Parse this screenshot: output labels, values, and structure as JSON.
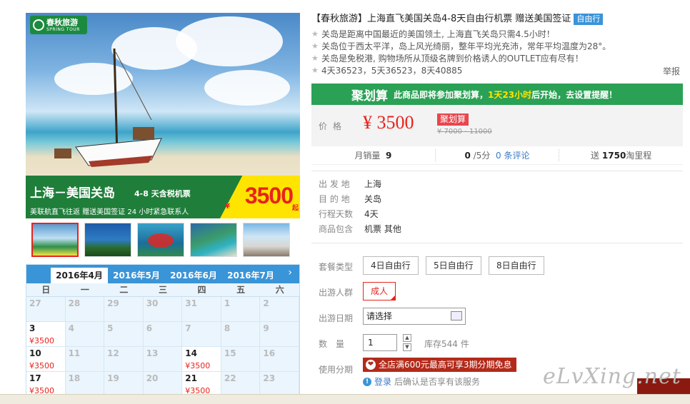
{
  "hero": {
    "logo_cn": "春秋旅游",
    "logo_en": "SPRING TOUR",
    "banner_title": "上海－美国关岛",
    "banner_sub": "4-8 天含税机票",
    "banner_line": "美联航直飞往返 赠送美国签证 24 小时紧急联系人",
    "banner_price": "3500",
    "banner_yen": "¥",
    "banner_qi": "起"
  },
  "thumbnails": [
    "thumb-1",
    "thumb-2",
    "thumb-3",
    "thumb-4",
    "thumb-5"
  ],
  "calendar": {
    "months": [
      "2016年4月",
      "2016年5月",
      "2016年6月",
      "2016年7月"
    ],
    "selected_month_index": 0,
    "next": "›",
    "weekdays": [
      "日",
      "一",
      "二",
      "三",
      "四",
      "五",
      "六"
    ],
    "days": [
      {
        "d": "27",
        "p": ""
      },
      {
        "d": "28",
        "p": ""
      },
      {
        "d": "29",
        "p": ""
      },
      {
        "d": "30",
        "p": ""
      },
      {
        "d": "31",
        "p": ""
      },
      {
        "d": "1",
        "p": ""
      },
      {
        "d": "2",
        "p": ""
      },
      {
        "d": "3",
        "p": "¥3500"
      },
      {
        "d": "4",
        "p": ""
      },
      {
        "d": "5",
        "p": ""
      },
      {
        "d": "6",
        "p": ""
      },
      {
        "d": "7",
        "p": ""
      },
      {
        "d": "8",
        "p": ""
      },
      {
        "d": "9",
        "p": ""
      },
      {
        "d": "10",
        "p": "¥3500"
      },
      {
        "d": "11",
        "p": ""
      },
      {
        "d": "12",
        "p": ""
      },
      {
        "d": "13",
        "p": ""
      },
      {
        "d": "14",
        "p": "¥3500"
      },
      {
        "d": "15",
        "p": ""
      },
      {
        "d": "16",
        "p": ""
      },
      {
        "d": "17",
        "p": "¥3500"
      },
      {
        "d": "18",
        "p": ""
      },
      {
        "d": "19",
        "p": ""
      },
      {
        "d": "20",
        "p": ""
      },
      {
        "d": "21",
        "p": "¥3500"
      },
      {
        "d": "22",
        "p": ""
      },
      {
        "d": "23",
        "p": ""
      }
    ]
  },
  "product": {
    "title": "【春秋旅游】上海直飞美国关岛4-8天自由行机票 赠送美国签证",
    "badge": "自由行",
    "features": [
      "关岛是距离中国最近的美国领土, 上海直飞关岛只需4.5小时！",
      "关岛位于西太平洋，岛上风光绮丽，整年平均光充沛，常年平均温度为28°。",
      "关岛是免税港, 购物场所从顶级名牌到价格诱人的OUTLET应有尽有！",
      "4天36523，5天36523，8天40885"
    ],
    "report": "举报"
  },
  "promo": {
    "logo": "聚划算",
    "msg_pre": "此商品即将参加聚划算，",
    "msg_highlight": "1天23小时",
    "msg_post": "后开始，去设置提醒！"
  },
  "price": {
    "label": "价格",
    "value": "¥ 3500",
    "tag": "聚划算",
    "old": "¥ 7000 - 11000"
  },
  "stats": {
    "sales_label": "月销量",
    "sales_value": "9",
    "rating_value": "0",
    "rating_suffix": "/5分",
    "reviews_value": "0",
    "reviews_label": "条评论",
    "points_pre": "送",
    "points_value": "1750",
    "points_post": "淘里程"
  },
  "info": [
    {
      "k": "出 发 地",
      "v": "上海"
    },
    {
      "k": "目 的 地",
      "v": "关岛"
    },
    {
      "k": "行程天数",
      "v": "4天"
    },
    {
      "k": "商品包含",
      "v": "机票  其他"
    }
  ],
  "options": {
    "package_label": "套餐类型",
    "packages": [
      "4日自由行",
      "5日自由行",
      "8日自由行"
    ],
    "group_label": "出游人群",
    "group_value": "成人",
    "date_label": "出游日期",
    "date_placeholder": "请选择",
    "qty_label": "数　量",
    "qty_value": "1",
    "stock": "库存544 件",
    "installment_label": "使用分期",
    "installment_text": "全店满600元最高可享3期分期免息",
    "login_link": "登录",
    "login_tip": "后确认是否享有该服务"
  },
  "watermark": "eLvXing.net"
}
